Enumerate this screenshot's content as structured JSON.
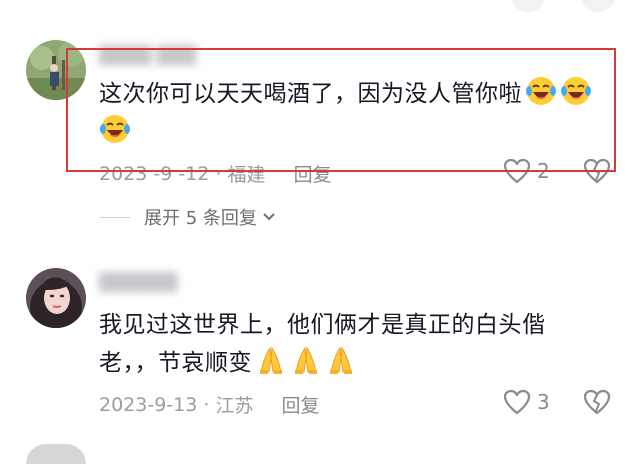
{
  "comments": [
    {
      "username": "████ ███",
      "text": "这次你可以天天喝酒了，因为没人管你啦",
      "emojis": [
        "laughing-tears-emoji",
        "laughing-tears-emoji",
        "laughing-tears-emoji"
      ],
      "date": "2023 -9 -12",
      "location": "福建",
      "reply_label": "回复",
      "like_count": "2",
      "replies_expand_label": "展开 5 条回复"
    },
    {
      "username": "██████",
      "text_line1": "我见过这世界上，他们俩才是真正的白头偕",
      "text_line2": "老，，节哀顺变",
      "emojis": [
        "praying-hands-emoji",
        "praying-hands-emoji",
        "praying-hands-emoji"
      ],
      "date": "2023-9-13",
      "location": "江苏",
      "reply_label": "回复",
      "like_count": "3"
    }
  ],
  "colors": {
    "highlight_box": "#d33a3a",
    "meta_text": "#9b9ba0",
    "comment_text": "#161823"
  }
}
